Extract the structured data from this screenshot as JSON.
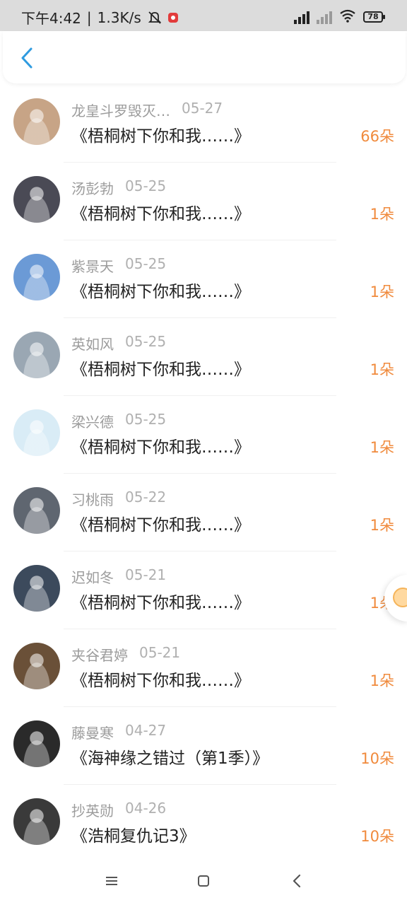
{
  "status_bar": {
    "time": "下午4:42",
    "speed": "1.3K/s",
    "battery": "78"
  },
  "list": [
    {
      "name": "龙皇斗罗毁灭…",
      "date": "05-27",
      "title": "《梧桐树下你和我……》",
      "count": "66朵",
      "avatar_color": "#c7a486"
    },
    {
      "name": "汤彭勃",
      "date": "05-25",
      "title": "《梧桐树下你和我……》",
      "count": "1朵",
      "avatar_color": "#4a4a55"
    },
    {
      "name": "紫景天",
      "date": "05-25",
      "title": "《梧桐树下你和我……》",
      "count": "1朵",
      "avatar_color": "#6b9ad6"
    },
    {
      "name": "英如风",
      "date": "05-25",
      "title": "《梧桐树下你和我……》",
      "count": "1朵",
      "avatar_color": "#9aa7b3"
    },
    {
      "name": "梁兴德",
      "date": "05-25",
      "title": "《梧桐树下你和我……》",
      "count": "1朵",
      "avatar_color": "#d9ecf6"
    },
    {
      "name": "习桃雨",
      "date": "05-22",
      "title": "《梧桐树下你和我……》",
      "count": "1朵",
      "avatar_color": "#5f6670"
    },
    {
      "name": "迟如冬",
      "date": "05-21",
      "title": "《梧桐树下你和我……》",
      "count": "1朵",
      "avatar_color": "#3c4a5c"
    },
    {
      "name": "夹谷君婷",
      "date": "05-21",
      "title": "《梧桐树下你和我……》",
      "count": "1朵",
      "avatar_color": "#6a5038"
    },
    {
      "name": "藤曼寒",
      "date": "04-27",
      "title": "《海神缘之错过（第1季）》",
      "count": "10朵",
      "avatar_color": "#2a2a2a"
    },
    {
      "name": "抄英勋",
      "date": "04-26",
      "title": "《浩桐复仇记3》",
      "count": "10朵",
      "avatar_color": "#3a3a3a"
    }
  ],
  "colors": {
    "accent_blue": "#2f9be0",
    "count_orange": "#f08a3c",
    "meta_gray": "#9c9c9c"
  },
  "icons": {
    "back": "chevron-left-icon",
    "nav_menu": "menu-icon",
    "nav_home": "home-square-icon",
    "nav_back": "back-triangle-icon"
  }
}
